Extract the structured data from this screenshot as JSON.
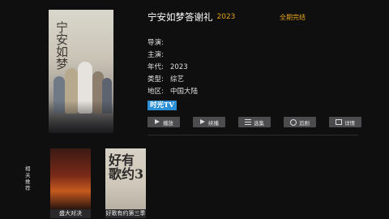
{
  "detail": {
    "title": "宁安如梦答谢礼",
    "year": "2023",
    "status": "全期完结",
    "fields": [
      {
        "key": "导演:",
        "value": ""
      },
      {
        "key": "主演:",
        "value": ""
      },
      {
        "key": "年代:",
        "value": "2023"
      },
      {
        "key": "类型:",
        "value": "综艺"
      },
      {
        "key": "地区:",
        "value": "中国大陆"
      }
    ],
    "platform": "时光TV",
    "poster_calligraphy": "宁安如梦"
  },
  "actions": [
    {
      "label": "播放",
      "icon": "play-icon"
    },
    {
      "label": "续播",
      "icon": "play-icon"
    },
    {
      "label": "选集",
      "icon": "list-icon"
    },
    {
      "label": "追剧",
      "icon": "heart-icon"
    },
    {
      "label": "详情",
      "icon": "detail-icon"
    }
  ],
  "related": {
    "label": "相关推荐",
    "items": [
      {
        "caption": "盛大对决"
      },
      {
        "caption": "好歌有约第三季",
        "poster_text": "好有歌约3"
      }
    ]
  }
}
